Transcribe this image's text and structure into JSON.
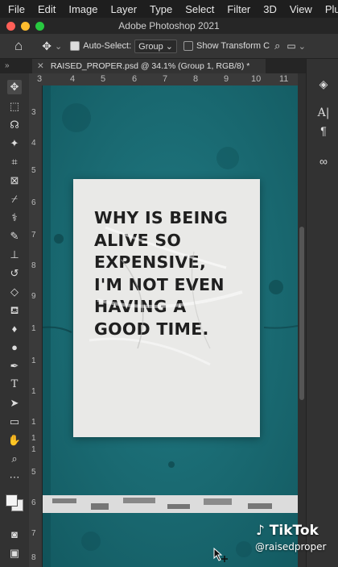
{
  "menubar": {
    "items": [
      "File",
      "Edit",
      "Image",
      "Layer",
      "Type",
      "Select",
      "Filter",
      "3D",
      "View",
      "Plug"
    ]
  },
  "window": {
    "title": "Adobe Photoshop 2021"
  },
  "options_bar": {
    "home_icon": "home-icon",
    "move_icon": "move-tool-icon",
    "auto_select_label": "Auto-Select:",
    "auto_select_checked": true,
    "auto_select_value": "Group",
    "show_transform_label": "Show Transform C"
  },
  "document_tab": {
    "label": "RAISED_PROPER.psd @ 34.1% (Group 1, RGB/8) *",
    "close_icon": "close-icon"
  },
  "rulers": {
    "horizontal": [
      "3",
      "4",
      "5",
      "6",
      "7",
      "8",
      "9",
      "10",
      "11"
    ],
    "vertical": [
      "3",
      "4",
      "5",
      "6",
      "7",
      "8",
      "9",
      "1",
      "1",
      "1",
      "1",
      "1",
      "1",
      "5",
      "6",
      "7",
      "8"
    ]
  },
  "poster": {
    "lines": [
      "WHY IS BEING",
      "ALIVE SO",
      "EXPENSIVE,",
      "I'M NOT EVEN",
      "HAVING A",
      "GOOD TIME."
    ]
  },
  "watermark": {
    "brand": "TikTok",
    "handle": "@raisedproper"
  },
  "colors": {
    "wall": "#1b6c74",
    "poster": "#e9e9e7",
    "ui_dark": "#323232"
  }
}
